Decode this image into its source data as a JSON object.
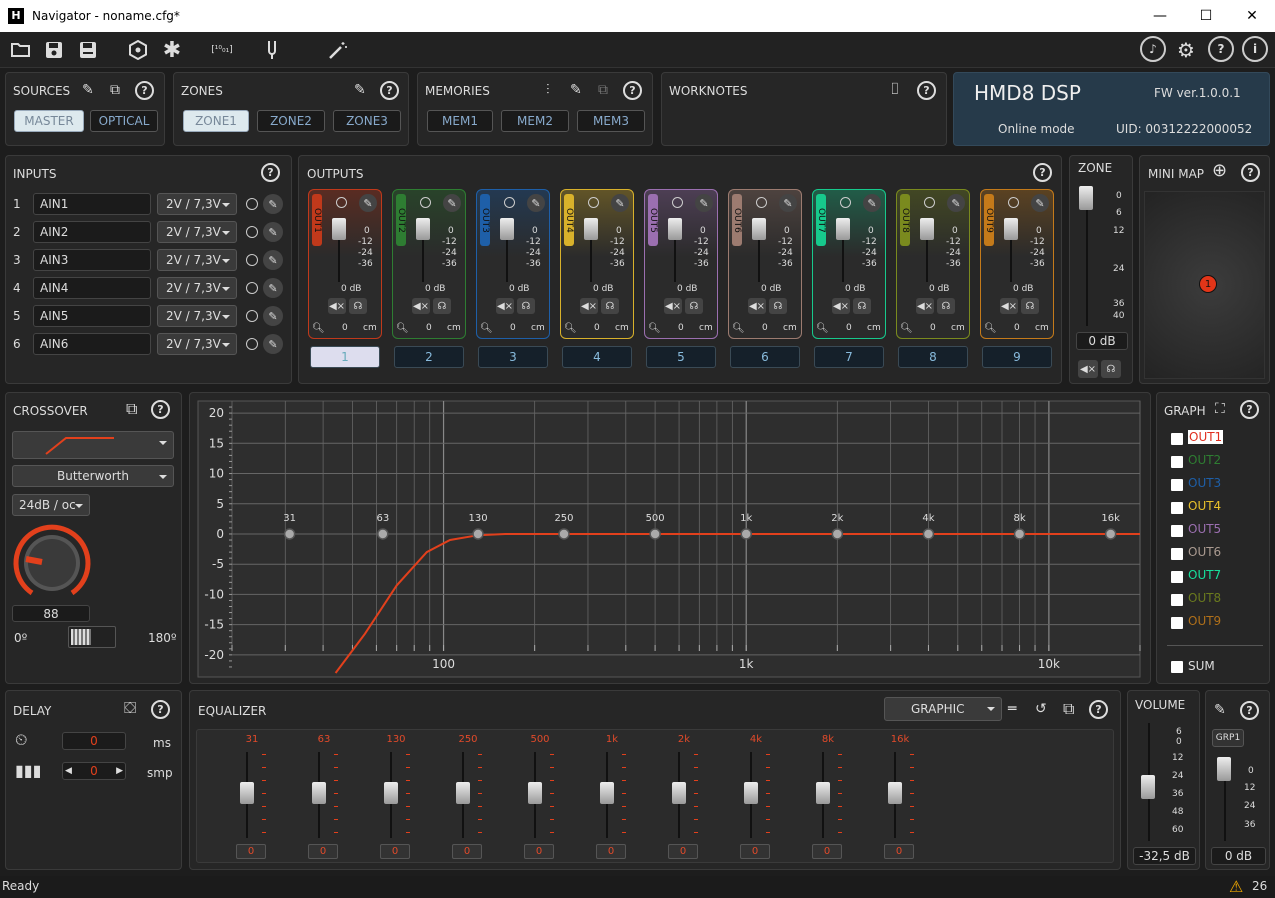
{
  "window": {
    "title": "Navigator - noname.cfg*",
    "logo": "H",
    "minimize": "—",
    "maximize": "☐",
    "close": "✕"
  },
  "toolbar": {
    "icons": [
      "folder-open-icon",
      "save-icon",
      "save-as-icon",
      "cube-icon",
      "asterisk-icon",
      "binary-icon",
      "tuning-icon",
      "magic-wand-icon"
    ],
    "right_icons": [
      "music-note-icon",
      "gear-icon",
      "help-icon",
      "info-icon"
    ],
    "help_symbol": "?",
    "info_symbol": "i"
  },
  "sources": {
    "title": "SOURCES",
    "buttons": [
      "MASTER",
      "OPTICAL"
    ]
  },
  "zones": {
    "title": "ZONES",
    "buttons": [
      "ZONE1",
      "ZONE2",
      "ZONE3"
    ]
  },
  "memories": {
    "title": "MEMORIES",
    "buttons": [
      "MEM1",
      "MEM2",
      "MEM3"
    ]
  },
  "worknotes": {
    "title": "WORKNOTES"
  },
  "device": {
    "name": "HMD8 DSP",
    "fw": "FW ver.1.0.0.1",
    "mode": "Online mode",
    "uid": "UID: 00312222000052"
  },
  "inputs": {
    "title": "INPUTS",
    "rows": [
      {
        "n": "1",
        "name": "AIN1",
        "level": "2V / 7,3V"
      },
      {
        "n": "2",
        "name": "AIN2",
        "level": "2V / 7,3V"
      },
      {
        "n": "3",
        "name": "AIN3",
        "level": "2V / 7,3V"
      },
      {
        "n": "4",
        "name": "AIN4",
        "level": "2V / 7,3V"
      },
      {
        "n": "5",
        "name": "AIN5",
        "level": "2V / 7,3V"
      },
      {
        "n": "6",
        "name": "AIN6",
        "level": "2V / 7,3V"
      }
    ]
  },
  "outputs": {
    "title": "OUTPUTS",
    "scale": [
      "0",
      "-12",
      "-24",
      "-36"
    ],
    "channels": [
      {
        "name": "OUT1",
        "color": "#c0391b",
        "db": "0 dB",
        "delay": "0",
        "unit": "cm",
        "num": "1"
      },
      {
        "name": "OUT2",
        "color": "#2e7d32",
        "db": "0 dB",
        "delay": "0",
        "unit": "cm",
        "num": "2"
      },
      {
        "name": "OUT3",
        "color": "#1e5fa8",
        "db": "0 dB",
        "delay": "0",
        "unit": "cm",
        "num": "3"
      },
      {
        "name": "OUT4",
        "color": "#d8b12b",
        "db": "0 dB",
        "delay": "0",
        "unit": "cm",
        "num": "4"
      },
      {
        "name": "OUT5",
        "color": "#9b6fb0",
        "db": "0 dB",
        "delay": "0",
        "unit": "cm",
        "num": "5"
      },
      {
        "name": "OUT6",
        "color": "#9c7b70",
        "db": "0 dB",
        "delay": "0",
        "unit": "cm",
        "num": "6"
      },
      {
        "name": "OUT7",
        "color": "#17c98c",
        "db": "0 dB",
        "delay": "0",
        "unit": "cm",
        "num": "7"
      },
      {
        "name": "OUT8",
        "color": "#7a8a1e",
        "db": "0 dB",
        "delay": "0",
        "unit": "cm",
        "num": "8"
      },
      {
        "name": "OUT9",
        "color": "#c47a1a",
        "db": "0 dB",
        "delay": "0",
        "unit": "cm",
        "num": "9"
      }
    ]
  },
  "zone": {
    "title": "ZONE",
    "scale": [
      "0",
      "6",
      "12",
      "24",
      "36",
      "40"
    ],
    "db": "0 dB"
  },
  "minimap": {
    "title": "MINI MAP",
    "marker": "1"
  },
  "crossover": {
    "title": "CROSSOVER",
    "type": "Butterworth",
    "slope": "24dB / oc",
    "freq": "88",
    "phase_left": "0º",
    "phase_right": "180º"
  },
  "chart_data": {
    "type": "line",
    "x_scale": "log",
    "xlim": [
      20,
      20000
    ],
    "ylim": [
      -23,
      22
    ],
    "yticks": [
      20,
      15,
      10,
      5,
      0,
      -5,
      -10,
      -15,
      -20
    ],
    "xticks": [
      "100",
      "1k",
      "10k"
    ],
    "xtick_values": [
      100,
      1000,
      10000
    ],
    "bands": [
      {
        "label": "31",
        "f": 31
      },
      {
        "label": "63",
        "f": 63
      },
      {
        "label": "130",
        "f": 130
      },
      {
        "label": "250",
        "f": 250
      },
      {
        "label": "500",
        "f": 500
      },
      {
        "label": "1k",
        "f": 1000
      },
      {
        "label": "2k",
        "f": 2000
      },
      {
        "label": "4k",
        "f": 4000
      },
      {
        "label": "8k",
        "f": 8000
      },
      {
        "label": "16k",
        "f": 16000
      }
    ],
    "series": [
      {
        "color": "#e2401c",
        "x": [
          44,
          55,
          70,
          88,
          105,
          130,
          160,
          200,
          20000
        ],
        "y": [
          -23,
          -16.5,
          -8.5,
          -3,
          -1,
          -0.2,
          0,
          0,
          0
        ]
      }
    ]
  },
  "graph": {
    "title": "GRAPH",
    "items": [
      {
        "label": "OUT1",
        "color": "#e03020"
      },
      {
        "label": "OUT2",
        "color": "#2e7d32"
      },
      {
        "label": "OUT3",
        "color": "#1e5fa8"
      },
      {
        "label": "OUT4",
        "color": "#e8c12b"
      },
      {
        "label": "OUT5",
        "color": "#9b6fb0"
      },
      {
        "label": "OUT6",
        "color": "#aa9a90"
      },
      {
        "label": "OUT7",
        "color": "#17e09c"
      },
      {
        "label": "OUT8",
        "color": "#6a7a1e"
      },
      {
        "label": "OUT9",
        "color": "#b0701a"
      }
    ],
    "sum": "SUM"
  },
  "delay": {
    "title": "DELAY",
    "ms_value": "0",
    "ms_unit": "ms",
    "smp_value": "0",
    "smp_unit": "smp"
  },
  "equalizer": {
    "title": "EQUALIZER",
    "mode": "GRAPHIC",
    "bands": [
      {
        "f": "31",
        "v": "0"
      },
      {
        "f": "63",
        "v": "0"
      },
      {
        "f": "130",
        "v": "0"
      },
      {
        "f": "250",
        "v": "0"
      },
      {
        "f": "500",
        "v": "0"
      },
      {
        "f": "1k",
        "v": "0"
      },
      {
        "f": "2k",
        "v": "0"
      },
      {
        "f": "4k",
        "v": "0"
      },
      {
        "f": "8k",
        "v": "0"
      },
      {
        "f": "16k",
        "v": "0"
      }
    ]
  },
  "volume": {
    "title": "VOLUME",
    "scale": [
      "6",
      "0",
      "12",
      "24",
      "36",
      "48",
      "60"
    ],
    "db": "-32,5 dB"
  },
  "group": {
    "button": "GRP1",
    "scale": [
      "0",
      "12",
      "24",
      "36"
    ],
    "db": "0 dB"
  },
  "status": {
    "text": "Ready",
    "warnings": "26"
  }
}
